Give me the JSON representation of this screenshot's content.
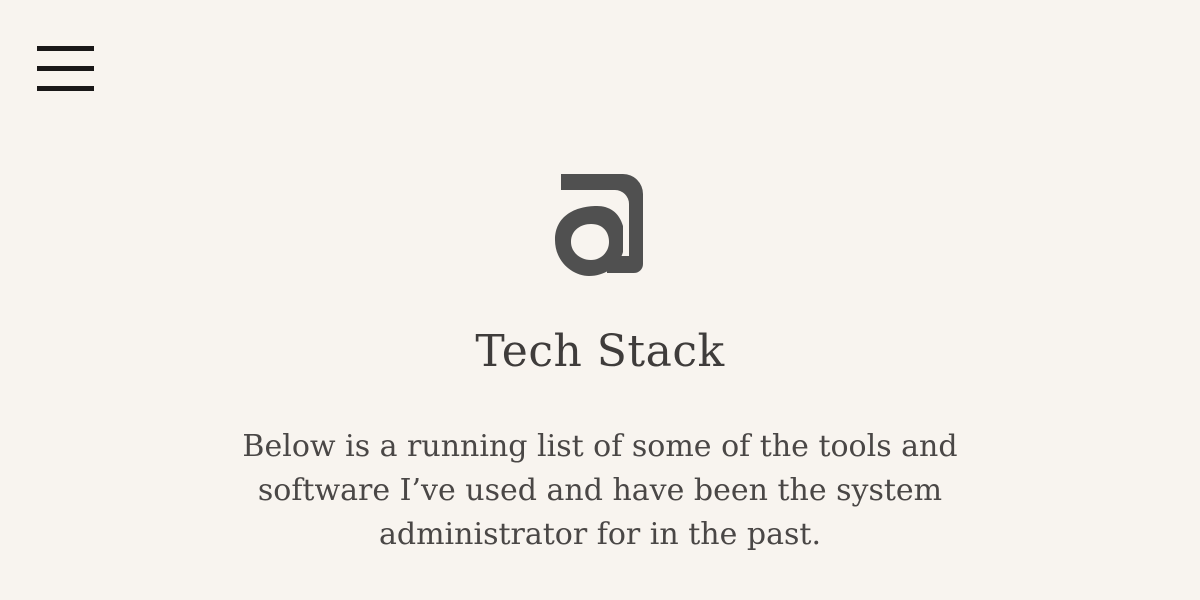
{
  "nav": {
    "menu_icon": "hamburger-menu-icon"
  },
  "logo": {
    "icon": "at-sign-logo-icon",
    "color": "#505050"
  },
  "page": {
    "title": "Tech Stack",
    "intro": "Below is a running list of some of the tools and software I’ve used and have been the system administrator for in the past."
  },
  "colors": {
    "background": "#f8f4ef",
    "text": "#4a4746",
    "menu": "#1a1818"
  }
}
